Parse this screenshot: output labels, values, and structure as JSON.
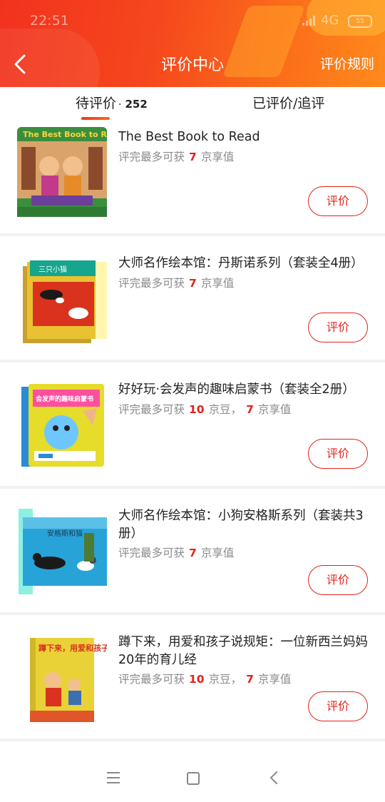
{
  "status_bar": {
    "time": "22:51",
    "network": "4G",
    "battery": "55"
  },
  "header": {
    "title": "评价中心",
    "rules_label": "评价规则",
    "back_icon": "chevron-left-icon"
  },
  "tabs": {
    "pending_label": "待评价",
    "pending_separator": "·",
    "pending_count": "252",
    "done_label": "已评价/追评"
  },
  "items": [
    {
      "title": "The Best Book to Read",
      "reward_prefix": "评完最多可获",
      "reward_num1": "7",
      "reward_unit1": "京享值",
      "reward_sep": "",
      "reward_num2": "",
      "reward_unit2": "",
      "button": "评价"
    },
    {
      "title": "大师名作绘本馆：丹斯诺系列（套装全4册）",
      "reward_prefix": "评完最多可获",
      "reward_num1": "7",
      "reward_unit1": "京享值",
      "reward_sep": "",
      "reward_num2": "",
      "reward_unit2": "",
      "button": "评价"
    },
    {
      "title": "好好玩·会发声的趣味启蒙书（套装全2册）",
      "reward_prefix": "评完最多可获",
      "reward_num1": "10",
      "reward_unit1": "京豆，",
      "reward_sep": "",
      "reward_num2": "7",
      "reward_unit2": "京享值",
      "button": "评价"
    },
    {
      "title": "大师名作绘本馆：小狗安格斯系列（套装共3册）",
      "reward_prefix": "评完最多可获",
      "reward_num1": "7",
      "reward_unit1": "京享值",
      "reward_sep": "",
      "reward_num2": "",
      "reward_unit2": "",
      "button": "评价"
    },
    {
      "title": "蹲下来，用爱和孩子说规矩：一位新西兰妈妈20年的育儿经",
      "reward_prefix": "评完最多可获",
      "reward_num1": "10",
      "reward_unit1": "京豆，",
      "reward_sep": "",
      "reward_num2": "7",
      "reward_unit2": "京享值",
      "button": "评价"
    }
  ],
  "covers": {
    "item0_title": "The Best Book to Read",
    "item1_title": "三只小猫",
    "item2_title": "会发声的趣味启蒙书",
    "item3_title": "安格斯和猫",
    "item4_title": "蹲下来，用爱和孩子说规矩"
  },
  "colors": {
    "accent": "#e2231a",
    "header_start": "#f2321e",
    "header_end": "#ff8a1b"
  }
}
